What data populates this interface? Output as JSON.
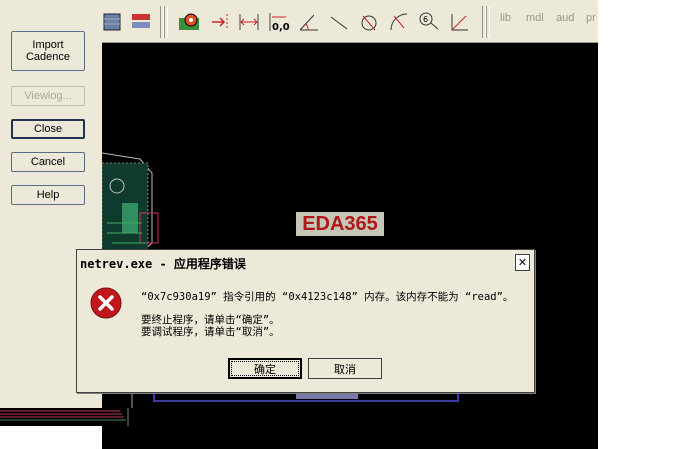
{
  "left_panel": {
    "buttons": {
      "import": "Import\nCadence",
      "viewlog": "Viewlog...",
      "close": "Close",
      "cancel": "Cancel",
      "help": "Help"
    }
  },
  "toolbar": {
    "text_buttons": [
      "lib",
      "mdl",
      "aud",
      "pr"
    ]
  },
  "watermark": "EDA365",
  "error_dialog": {
    "title": "netrev.exe - 应用程序错误",
    "close_glyph": "✕",
    "line1": "“0x7c930a19” 指令引用的 “0x4123c148” 内存。该内存不能为 “read”。",
    "line2": "要终止程序，请单击“确定”。",
    "line3": "要调试程序，请单击“取消”。",
    "ok_label": "确定",
    "cancel_label": "取消"
  },
  "colors": {
    "dialog_bg": "#ece9d8",
    "canvas_bg": "#000000",
    "watermark_text": "#b01818",
    "error_icon": "#c0161c"
  }
}
